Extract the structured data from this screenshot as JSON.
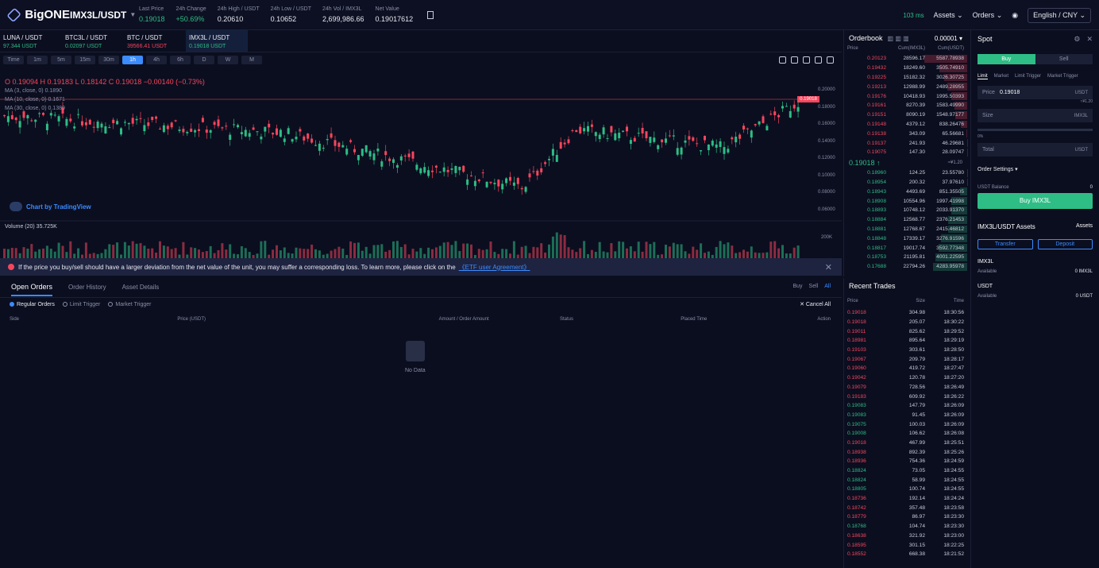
{
  "header": {
    "brand": "BigONE",
    "pair": "IMX3L/USDT",
    "stats": [
      {
        "label": "Last Price",
        "value": "0.19018",
        "tone": "green"
      },
      {
        "label": "24h Change",
        "value": "+50.69%",
        "tone": "green"
      },
      {
        "label": "24h High / USDT",
        "value": "0.20610",
        "tone": ""
      },
      {
        "label": "24h Low / USDT",
        "value": "0.10652",
        "tone": ""
      },
      {
        "label": "24h Vol / IMX3L",
        "value": "2,699,986.66",
        "tone": ""
      },
      {
        "label": "Net Value",
        "value": "0.19017612",
        "tone": ""
      }
    ],
    "latency": "103 ms",
    "assets": "Assets",
    "orders": "Orders",
    "language": "English / CNY"
  },
  "market_tabs": [
    {
      "pair": "LUNA / USDT",
      "value": "97.344 USDT",
      "tone": "green"
    },
    {
      "pair": "BTC3L / USDT",
      "value": "0.02097 USDT",
      "tone": "green"
    },
    {
      "pair": "BTC / USDT",
      "value": "39566.41 USDT",
      "tone": "red"
    },
    {
      "pair": "IMX3L / USDT",
      "value": "0.19018 USDT",
      "tone": "green"
    }
  ],
  "intervals": [
    "Time",
    "1m",
    "5m",
    "15m",
    "30m",
    "1h",
    "4h",
    "6h",
    "D",
    "W",
    "M"
  ],
  "chart": {
    "ohlc": "O 0.19094  H 0.19183  L 0.18142  C 0.19018  −0.00140 (−0.73%)",
    "ma1": "MA (3, close, 0)  0.1890",
    "ma2": "MA (10, close, 0)  0.1671",
    "ma3": "MA (30, close, 0)  0.1389",
    "tv": "Chart by TradingView",
    "volume": "Volume (20)  35.725K",
    "y_ticks": [
      "0.20000",
      "0.18000",
      "0.16000",
      "0.14000",
      "0.12000",
      "0.10000",
      "0.08000",
      "0.06000"
    ],
    "price_tag": "0.19018",
    "vol_tick": "200K"
  },
  "warning": {
    "text": "If the price you buy/sell should have a larger deviation from the net value of the unit, you may suffer a corresponding loss. To learn more, please click on the",
    "link": "《ETF user Agreement》"
  },
  "orders": {
    "tabs": [
      "Open Orders",
      "Order History",
      "Asset Details"
    ],
    "filter": [
      "Buy",
      "Sell",
      "All"
    ],
    "types": [
      "Regular Orders",
      "Limit Trigger",
      "Market Trigger"
    ],
    "cancel_all": "✕ Cancel All",
    "columns": [
      "Side",
      "Price (USDT)",
      "Amount / Order Amount",
      "Status",
      "Placed Time",
      "Action"
    ],
    "empty": "No Data"
  },
  "orderbook": {
    "title": "Orderbook",
    "step": "0.00001",
    "columns": [
      "Price",
      "Cum(IMX3L)",
      "Cum(USDT)"
    ],
    "asks": [
      [
        "0.20123",
        "28596.17",
        "5587.78938"
      ],
      [
        "0.19432",
        "18249.60",
        "3505.74910"
      ],
      [
        "0.19225",
        "15182.32",
        "3026.30725"
      ],
      [
        "0.19213",
        "12988.99",
        "2489.28955"
      ],
      [
        "0.19176",
        "10418.93",
        "1995.50393"
      ],
      [
        "0.19161",
        "8270.39",
        "1583.49990"
      ],
      [
        "0.19151",
        "8090.19",
        "1548.97177"
      ],
      [
        "0.19148",
        "4379.12",
        "838.26476"
      ],
      [
        "0.19138",
        "343.09",
        "65.56681"
      ],
      [
        "0.19137",
        "241.93",
        "46.29681"
      ],
      [
        "0.19075",
        "147.30",
        "28.09747"
      ]
    ],
    "mid": "0.19018 ↑",
    "mid_ref": "≈¥1.20",
    "bids": [
      [
        "0.18960",
        "124.25",
        "23.55780"
      ],
      [
        "0.18954",
        "200.32",
        "37.97610"
      ],
      [
        "0.18943",
        "4493.69",
        "851.35505"
      ],
      [
        "0.18908",
        "10554.96",
        "1997.41998"
      ],
      [
        "0.18893",
        "10748.12",
        "2033.91370"
      ],
      [
        "0.18884",
        "12568.77",
        "2376.21453"
      ],
      [
        "0.18881",
        "12768.67",
        "2415.46812"
      ],
      [
        "0.18848",
        "17339.17",
        "3276.91596"
      ],
      [
        "0.18817",
        "19017.74",
        "3592.77348"
      ],
      [
        "0.18753",
        "21195.81",
        "4001.22595"
      ],
      [
        "0.17688",
        "22794.26",
        "4283.95978"
      ]
    ]
  },
  "trades": {
    "title": "Recent Trades",
    "columns": [
      "Price",
      "Size",
      "Time"
    ],
    "rows": [
      [
        "0.19018",
        "304.98",
        "18:30:56",
        "red"
      ],
      [
        "0.19018",
        "205.07",
        "18:30:22",
        "red"
      ],
      [
        "0.19011",
        "825.62",
        "18:29:52",
        "red"
      ],
      [
        "0.18981",
        "895.64",
        "18:29:19",
        "red"
      ],
      [
        "0.19103",
        "303.61",
        "18:28:50",
        "red"
      ],
      [
        "0.19067",
        "209.79",
        "18:28:17",
        "red"
      ],
      [
        "0.19060",
        "419.72",
        "18:27:47",
        "red"
      ],
      [
        "0.19042",
        "120.78",
        "18:27:20",
        "red"
      ],
      [
        "0.19079",
        "728.56",
        "18:26:49",
        "red"
      ],
      [
        "0.19183",
        "609.92",
        "18:26:22",
        "red"
      ],
      [
        "0.19083",
        "147.79",
        "18:26:09",
        "green"
      ],
      [
        "0.19083",
        "91.45",
        "18:26:09",
        "green"
      ],
      [
        "0.19075",
        "100.03",
        "18:26:09",
        "green"
      ],
      [
        "0.19008",
        "106.62",
        "18:26:08",
        "green"
      ],
      [
        "0.19018",
        "467.99",
        "18:25:51",
        "red"
      ],
      [
        "0.18938",
        "892.39",
        "18:25:26",
        "red"
      ],
      [
        "0.18936",
        "754.36",
        "18:24:59",
        "red"
      ],
      [
        "0.18824",
        "73.05",
        "18:24:55",
        "green"
      ],
      [
        "0.18824",
        "58.99",
        "18:24:55",
        "green"
      ],
      [
        "0.18805",
        "100.74",
        "18:24:55",
        "green"
      ],
      [
        "0.18736",
        "192.14",
        "18:24:24",
        "red"
      ],
      [
        "0.18742",
        "357.48",
        "18:23:58",
        "red"
      ],
      [
        "0.18779",
        "86.97",
        "18:23:30",
        "red"
      ],
      [
        "0.18768",
        "104.74",
        "18:23:30",
        "green"
      ],
      [
        "0.18638",
        "321.92",
        "18:23:00",
        "red"
      ],
      [
        "0.18595",
        "301.15",
        "18:22:25",
        "red"
      ],
      [
        "0.18552",
        "668.38",
        "18:21:52",
        "red"
      ]
    ]
  },
  "panel": {
    "title": "Spot",
    "buy": "Buy",
    "sell": "Sell",
    "order_types": [
      "Limit",
      "Market",
      "Limit Trigger",
      "Market Trigger"
    ],
    "price_label": "Price",
    "price_value": "0.19018",
    "price_unit": "USDT",
    "price_ref": "≈¥1.20",
    "size_label": "Size",
    "size_unit": "IMX3L",
    "slider_label": "0%",
    "total_label": "Total",
    "total_unit": "USDT",
    "order_settings": "Order Settings ▾",
    "balance_label": "USDT Balance",
    "balance_value": "0",
    "buy_button": "Buy IMX3L",
    "assets_title": "IMX3L/USDT Assets",
    "assets_link": "Assets",
    "transfer": "Transfer",
    "deposit": "Deposit",
    "coin1": "IMX3L",
    "coin1_label": "Available",
    "coin1_value": "0 IMX3L",
    "coin2": "USDT",
    "coin2_label": "Available",
    "coin2_value": "0 USDT"
  }
}
